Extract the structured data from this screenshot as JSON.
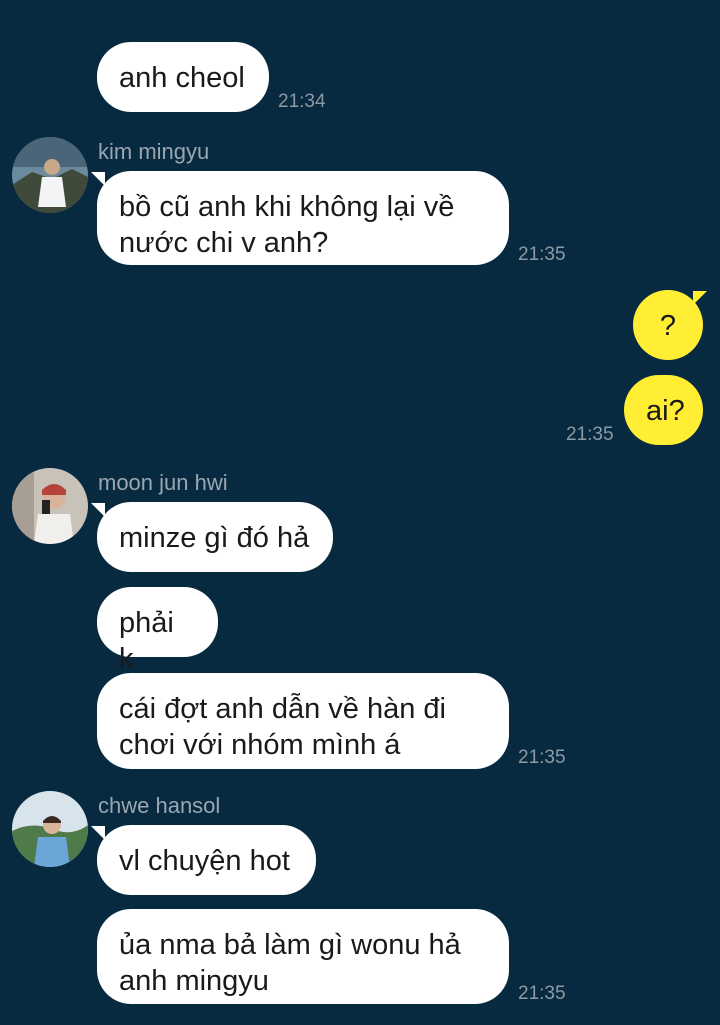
{
  "messages": {
    "m1": {
      "text": "anh cheol",
      "time": "21:34"
    },
    "g1": {
      "sender": "kim mingyu",
      "m1": "bồ cũ anh khi không lại về\nnước chi v anh?",
      "time": "21:35"
    },
    "mine": {
      "m1": "?",
      "m2": "ai?",
      "time": "21:35"
    },
    "g2": {
      "sender": "moon jun hwi",
      "m1": "minze gì đó hả",
      "m2": "phải k",
      "m3": "cái đợt anh dẫn về hàn đi\nchơi với nhóm mình á",
      "time": "21:35"
    },
    "g3": {
      "sender": "chwe hansol",
      "m1": "vl chuyện hot",
      "m2": "ủa nma bả làm gì wonu hả\nanh mingyu",
      "time": "21:35"
    }
  },
  "colors": {
    "background": "#072a40",
    "incoming_bubble": "#ffffff",
    "outgoing_bubble": "#ffee33",
    "timestamp": "#8d99a3",
    "sender_name": "#9aa6b0"
  },
  "icons": [
    "avatar-kim-mingyu",
    "avatar-moon-jun-hwi",
    "avatar-chwe-hansol"
  ]
}
